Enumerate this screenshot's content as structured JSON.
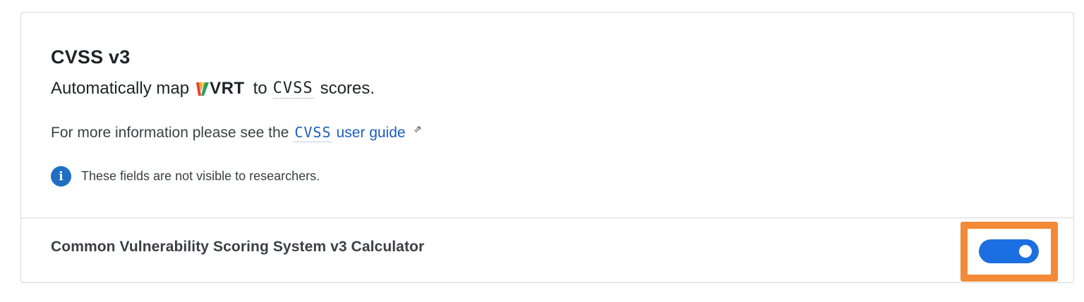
{
  "header": {
    "title": "CVSS v3",
    "subtitle_prefix": "Automatically map",
    "vrt_label": "VRT",
    "subtitle_to": "to",
    "cvss_abbr": "CVSS",
    "subtitle_suffix": "scores."
  },
  "info": {
    "text": "For more information please see the",
    "link_abbr": "CVSS",
    "link_text": "user guide",
    "external_icon": "external-link-icon"
  },
  "notice": {
    "icon": "info-icon",
    "icon_glyph": "i",
    "text": "These fields are not visible to researchers."
  },
  "calculator": {
    "label": "Common Vulnerability Scoring System v3 Calculator",
    "enabled": true
  },
  "colors": {
    "toggle_on": "#1c6fe0",
    "link": "#1a5fc0",
    "info_icon": "#1e6fc4",
    "highlight": "#f28a37"
  }
}
